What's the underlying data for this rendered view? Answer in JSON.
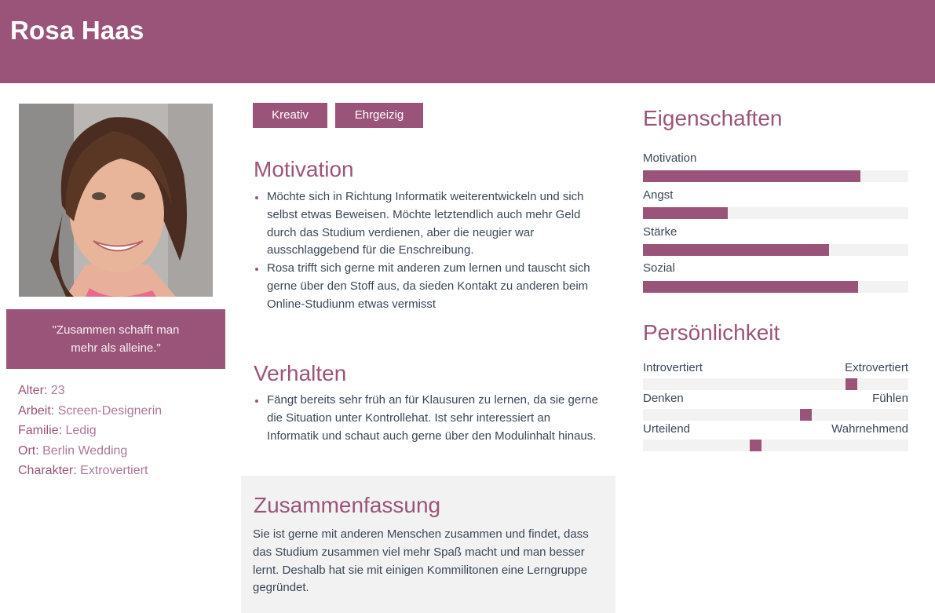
{
  "persona": {
    "name": "Rosa Haas",
    "quote": "\"Zusammen schafft man mehr als alleine.\"",
    "facts": [
      {
        "label": "Alter",
        "value": "23"
      },
      {
        "label": "Arbeit",
        "value": "Screen-Designerin"
      },
      {
        "label": "Familie",
        "value": "Ledig"
      },
      {
        "label": "Ort",
        "value": "Berlin Wedding"
      },
      {
        "label": "Charakter",
        "value": "Extrovertiert"
      }
    ]
  },
  "tags": [
    "Kreativ",
    "Ehrgeizig"
  ],
  "motivation": {
    "title": "Motivation",
    "items": [
      "Möchte sich in Richtung Informatik weiterentwickeln und sich selbst etwas Beweisen. Möchte letztendlich auch mehr Geld durch das Studium verdienen, aber die neugier war ausschlaggebend für die Enschreibung.",
      "Rosa trifft sich gerne mit anderen zum lernen und tauscht sich gerne über den Stoff aus, da sieden Kontakt zu anderen beim Online-Studiunm etwas vermisst"
    ]
  },
  "verhalten": {
    "title": "Verhalten",
    "items": [
      "Fängt bereits sehr früh an für Klausuren zu lernen, da sie gerne die Situation unter Kontrollehat. Ist sehr interessiert an Informatik und schaut auch gerne über den Modulinhalt hinaus."
    ]
  },
  "summary": {
    "title": "Zusammenfassung",
    "text": "Sie ist gerne mit anderen Menschen zusammen und findet, dass das Studium zusammen viel mehr Spaß macht und man besser lernt. Deshalb hat sie mit einigen Kommilitonen eine Lerngruppe gegründet."
  },
  "eigenschaften": {
    "title": "Eigenschaften",
    "bars": [
      {
        "label": "Motivation",
        "value": 0.82
      },
      {
        "label": "Angst",
        "value": 0.32
      },
      {
        "label": "Stärke",
        "value": 0.7
      },
      {
        "label": "Sozial",
        "value": 0.81
      }
    ]
  },
  "persoenlichkeit": {
    "title": "Persönlichkeit",
    "scales": [
      {
        "left": "Introvertiert",
        "right": "Extrovertiert",
        "value": 0.8
      },
      {
        "left": "Denken",
        "right": "Fühlen",
        "value": 0.62
      },
      {
        "left": "Urteilend",
        "right": "Wahrnehmend",
        "value": 0.42
      }
    ]
  },
  "colors": {
    "accent": "#9b5479",
    "track": "#f2f2f2"
  }
}
